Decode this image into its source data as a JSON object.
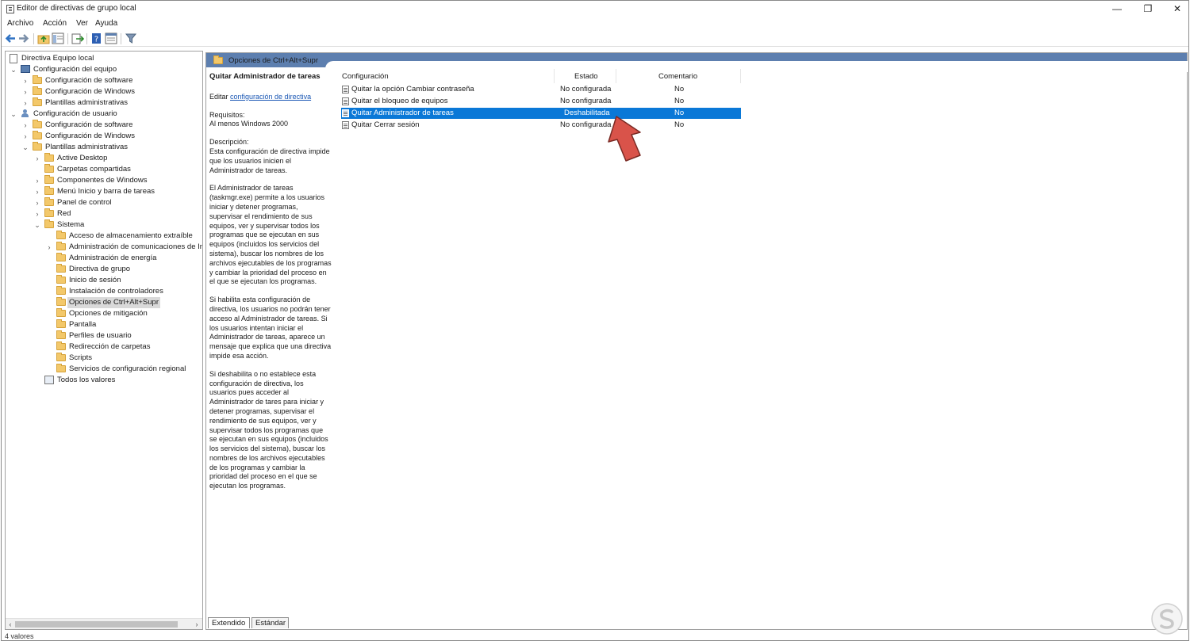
{
  "window": {
    "title": "Editor de directivas de grupo local",
    "min": "—",
    "max": "❐",
    "close": "✕"
  },
  "menu": [
    "Archivo",
    "Acción",
    "Ver",
    "Ayuda"
  ],
  "tree": {
    "root": "Directiva Equipo local",
    "items": [
      {
        "label": "Configuración del equipo"
      },
      {
        "label": "Configuración de software"
      },
      {
        "label": "Configuración de Windows"
      },
      {
        "label": "Plantillas administrativas"
      },
      {
        "label": "Configuración de usuario"
      },
      {
        "label": "Configuración de software"
      },
      {
        "label": "Configuración de Windows"
      },
      {
        "label": "Plantillas administrativas"
      },
      {
        "label": "Active Desktop"
      },
      {
        "label": "Carpetas compartidas"
      },
      {
        "label": "Componentes de Windows"
      },
      {
        "label": "Menú Inicio y barra de tareas"
      },
      {
        "label": "Panel de control"
      },
      {
        "label": "Red"
      },
      {
        "label": "Sistema"
      },
      {
        "label": "Acceso de almacenamiento extraíble"
      },
      {
        "label": "Administración de comunicaciones de In"
      },
      {
        "label": "Administración de energía"
      },
      {
        "label": "Directiva de grupo"
      },
      {
        "label": "Inicio de sesión"
      },
      {
        "label": "Instalación de controladores"
      },
      {
        "label": "Opciones de Ctrl+Alt+Supr"
      },
      {
        "label": "Opciones de mitigación"
      },
      {
        "label": "Pantalla"
      },
      {
        "label": "Perfiles de usuario"
      },
      {
        "label": "Redirección de carpetas"
      },
      {
        "label": "Scripts"
      },
      {
        "label": "Servicios de configuración regional"
      },
      {
        "label": "Todos los valores"
      }
    ]
  },
  "header": {
    "title": "Opciones de Ctrl+Alt+Supr"
  },
  "description": {
    "title": "Quitar Administrador de tareas",
    "edit_prefix": "Editar ",
    "edit_link": "configuración de directiva",
    "req_label": "Requisitos:",
    "req_value": "Al menos Windows 2000",
    "desc_label": "Descripción:",
    "p1": "Esta configuración de directiva impide que los usuarios inicien el Administrador de tareas.",
    "p2": "El Administrador de tareas (taskmgr.exe) permite a los usuarios iniciar y detener programas, supervisar el rendimiento de sus equipos, ver y supervisar todos los programas que se ejecutan en sus equipos (incluidos los servicios del sistema), buscar los nombres de los archivos ejecutables de los programas y cambiar la prioridad del proceso en el que se ejecutan los programas.",
    "p3": "Si habilita esta configuración de directiva, los usuarios no podrán tener acceso al Administrador de tareas. Si los usuarios intentan iniciar el Administrador de tareas, aparece un mensaje que explica que una directiva impide esa acción.",
    "p4": "Si deshabilita o no establece esta configuración de directiva, los usuarios pues acceder al Administrador de tares para iniciar y detener programas, supervisar el rendimiento de sus equipos, ver y supervisar todos los programas que se ejecutan en sus equipos (incluidos los servicios del sistema), buscar los nombres de los archivos ejecutables de los programas y cambiar la prioridad del proceso en el que se ejecutan los programas."
  },
  "list": {
    "columns": [
      "Configuración",
      "Estado",
      "Comentario"
    ],
    "rows": [
      {
        "name": "Quitar la opción Cambiar contraseña",
        "state": "No configurada",
        "comment": "No"
      },
      {
        "name": "Quitar el bloqueo de equipos",
        "state": "No configurada",
        "comment": "No"
      },
      {
        "name": "Quitar Administrador de tareas",
        "state": "Deshabilitada",
        "comment": "No"
      },
      {
        "name": "Quitar Cerrar sesión",
        "state": "No configurada",
        "comment": "No"
      }
    ]
  },
  "tabs": [
    "Extendido",
    "Estándar"
  ],
  "status": "4 valores",
  "colors": {
    "header_band": "#5d7faf",
    "selection": "#0a78d7",
    "arrow": "#d9534a"
  }
}
